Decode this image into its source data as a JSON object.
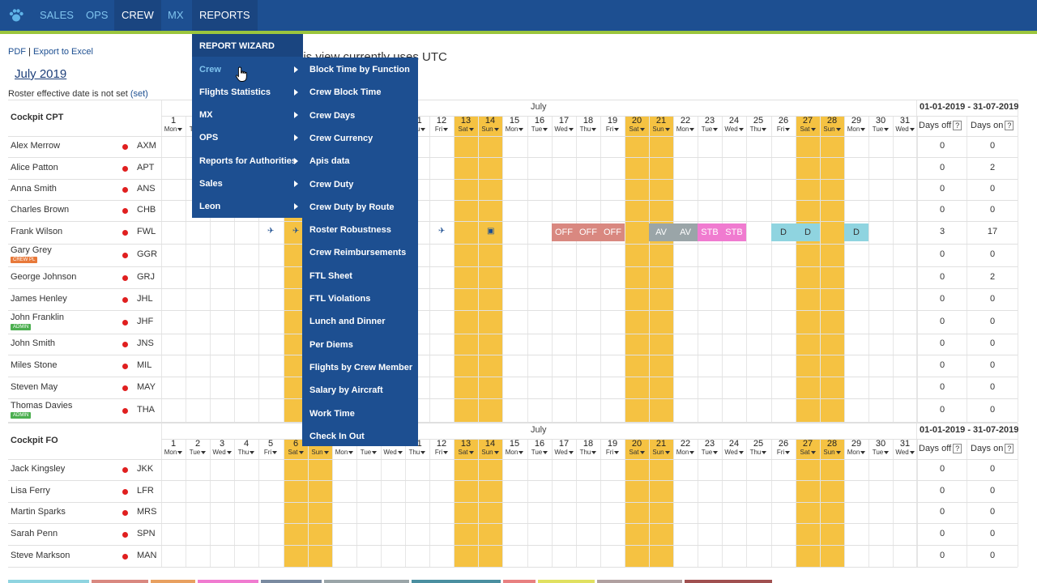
{
  "nav": {
    "items": [
      "SALES",
      "OPS",
      "CREW",
      "MX",
      "REPORTS"
    ],
    "logo_icon": "paw-icon",
    "colors": {
      "bar": "#1d4f91",
      "accent_line": "#9bc53d",
      "link": "#7fc3ee"
    }
  },
  "header": {
    "pdf": "PDF",
    "separator": "|",
    "excel": "Export to Excel",
    "month_title": "July 2019",
    "roster_note": "Roster effective date is not set",
    "roster_set": "(set)",
    "utc_note": "his view currently uses UTC"
  },
  "grid": {
    "month": "July",
    "range": "01-01-2019 - 31-07-2019",
    "days_off_label": "Days off",
    "days_on_label": "Days on",
    "help": "?",
    "days": [
      {
        "n": "1",
        "d": "Mon"
      },
      {
        "n": "2",
        "d": "Tue"
      },
      {
        "n": "3",
        "d": "Wed"
      },
      {
        "n": "4",
        "d": "Thu"
      },
      {
        "n": "5",
        "d": "Fri"
      },
      {
        "n": "6",
        "d": "Sat"
      },
      {
        "n": "7",
        "d": "Sun"
      },
      {
        "n": "8",
        "d": "Mon"
      },
      {
        "n": "9",
        "d": "Tue"
      },
      {
        "n": "10",
        "d": "Wed"
      },
      {
        "n": "11",
        "d": "Thu"
      },
      {
        "n": "12",
        "d": "Fri"
      },
      {
        "n": "13",
        "d": "Sat"
      },
      {
        "n": "14",
        "d": "Sun"
      },
      {
        "n": "15",
        "d": "Mon"
      },
      {
        "n": "16",
        "d": "Tue"
      },
      {
        "n": "17",
        "d": "Wed"
      },
      {
        "n": "18",
        "d": "Thu"
      },
      {
        "n": "19",
        "d": "Fri"
      },
      {
        "n": "20",
        "d": "Sat"
      },
      {
        "n": "21",
        "d": "Sun"
      },
      {
        "n": "22",
        "d": "Mon"
      },
      {
        "n": "23",
        "d": "Tue"
      },
      {
        "n": "24",
        "d": "Wed"
      },
      {
        "n": "25",
        "d": "Thu"
      },
      {
        "n": "26",
        "d": "Fri"
      },
      {
        "n": "27",
        "d": "Sat"
      },
      {
        "n": "28",
        "d": "Sun"
      },
      {
        "n": "29",
        "d": "Mon"
      },
      {
        "n": "30",
        "d": "Tue"
      },
      {
        "n": "31",
        "d": "Wed"
      }
    ],
    "weekend_color": "#f5c242",
    "sections": [
      {
        "title": "Cockpit CPT",
        "crew": [
          {
            "name": "Alex Merrow",
            "code": "AXM",
            "off": "0",
            "on": "0"
          },
          {
            "name": "Alice Patton",
            "code": "APT",
            "off": "0",
            "on": "2"
          },
          {
            "name": "Anna Smith",
            "code": "ANS",
            "off": "0",
            "on": "0"
          },
          {
            "name": "Charles Brown",
            "code": "CHB",
            "off": "0",
            "on": "0"
          },
          {
            "name": "Frank Wilson",
            "code": "FWL",
            "off": "3",
            "on": "17"
          },
          {
            "name": "Gary Grey",
            "code": "GGR",
            "off": "0",
            "on": "0",
            "tag": "CREW PL",
            "tag_color": "#e8793a"
          },
          {
            "name": "George Johnson",
            "code": "GRJ",
            "off": "0",
            "on": "2"
          },
          {
            "name": "James Henley",
            "code": "JHL",
            "off": "0",
            "on": "0"
          },
          {
            "name": "John Franklin",
            "code": "JHF",
            "off": "0",
            "on": "0",
            "tag": "ADMIN",
            "tag_color": "#4caf50"
          },
          {
            "name": "John Smith",
            "code": "JNS",
            "off": "0",
            "on": "0"
          },
          {
            "name": "Miles Stone",
            "code": "MIL",
            "off": "0",
            "on": "0"
          },
          {
            "name": "Steven May",
            "code": "MAY",
            "off": "0",
            "on": "0"
          },
          {
            "name": "Thomas Davies",
            "code": "THA",
            "off": "0",
            "on": "0",
            "tag": "ADMIN",
            "tag_color": "#4caf50"
          }
        ]
      },
      {
        "title": "Cockpit FO",
        "crew": [
          {
            "name": "Jack Kingsley",
            "code": "JKK",
            "off": "0",
            "on": "0"
          },
          {
            "name": "Lisa Ferry",
            "code": "LFR",
            "off": "0",
            "on": "0"
          },
          {
            "name": "Martin Sparks",
            "code": "MRS",
            "off": "0",
            "on": "0"
          },
          {
            "name": "Sarah Penn",
            "code": "SPN",
            "off": "0",
            "on": "0"
          },
          {
            "name": "Steve Markson",
            "code": "MAN",
            "off": "0",
            "on": "0"
          }
        ]
      }
    ],
    "frank_duties": [
      {
        "day": 17,
        "label": "OFF",
        "bg": "#d98880"
      },
      {
        "day": 18,
        "label": "OFF",
        "bg": "#d98880"
      },
      {
        "day": 19,
        "label": "OFF",
        "bg": "#d98880"
      },
      {
        "day": 21,
        "label": "AV",
        "bg": "#9aa5a8"
      },
      {
        "day": 22,
        "label": "AV",
        "bg": "#9aa5a8"
      },
      {
        "day": 23,
        "label": "STB",
        "bg": "#f07bd0"
      },
      {
        "day": 24,
        "label": "STB",
        "bg": "#f07bd0"
      },
      {
        "day": 26,
        "label": "D",
        "bg": "#8fd4e0"
      },
      {
        "day": 27,
        "label": "D",
        "bg": "#8fd4e0"
      },
      {
        "day": 29,
        "label": "D",
        "bg": "#8fd4e0"
      }
    ]
  },
  "reports_menu": {
    "header": "REPORT WIZARD",
    "items": [
      "Crew",
      "Flights Statistics",
      "MX",
      "OPS",
      "Reports for Authorities",
      "Sales",
      "Leon"
    ],
    "crew_submenu": [
      "Block Time by Function",
      "Crew Block Time",
      "Crew Days",
      "Crew Currency",
      "Apis data",
      "Crew Duty",
      "Crew Duty by Route",
      "Roster Robustness",
      "Crew Reimbursements",
      "FTL Sheet",
      "FTL Violations",
      "Lunch and Dinner",
      "Per Diems",
      "Flights by Crew Member",
      "Salary by Aircraft",
      "Work Time",
      "Check In Out"
    ]
  }
}
